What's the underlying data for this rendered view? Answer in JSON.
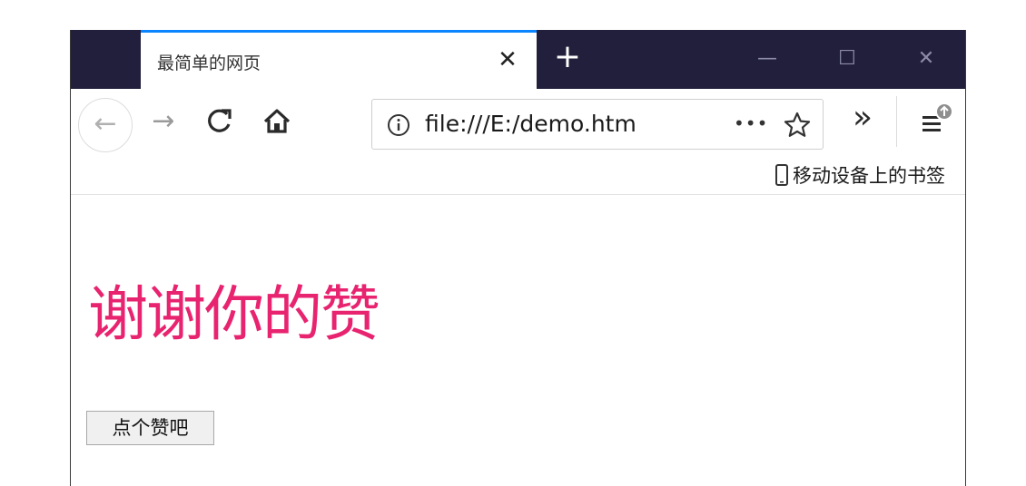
{
  "browser": {
    "tab": {
      "title": "最简单的网页",
      "close_glyph": "✕"
    },
    "new_tab_glyph": "+",
    "window_controls": {
      "minimize": "—",
      "maximize": "☐",
      "close": "✕"
    },
    "toolbar": {
      "back_glyph": "←",
      "forward_glyph": "→",
      "reload_glyph": "C",
      "url": "file:///E:/demo.htm",
      "page_actions_glyph": "•••",
      "overflow_glyph": "»"
    },
    "bookmarks": {
      "mobile_label": "移动设备上的书签"
    }
  },
  "page": {
    "heading": "谢谢你的赞",
    "button_label": "点个赞吧"
  },
  "colors": {
    "titlebar": "#211f3c",
    "tab_accent": "#0a84ff",
    "heading": "#e8236f"
  }
}
